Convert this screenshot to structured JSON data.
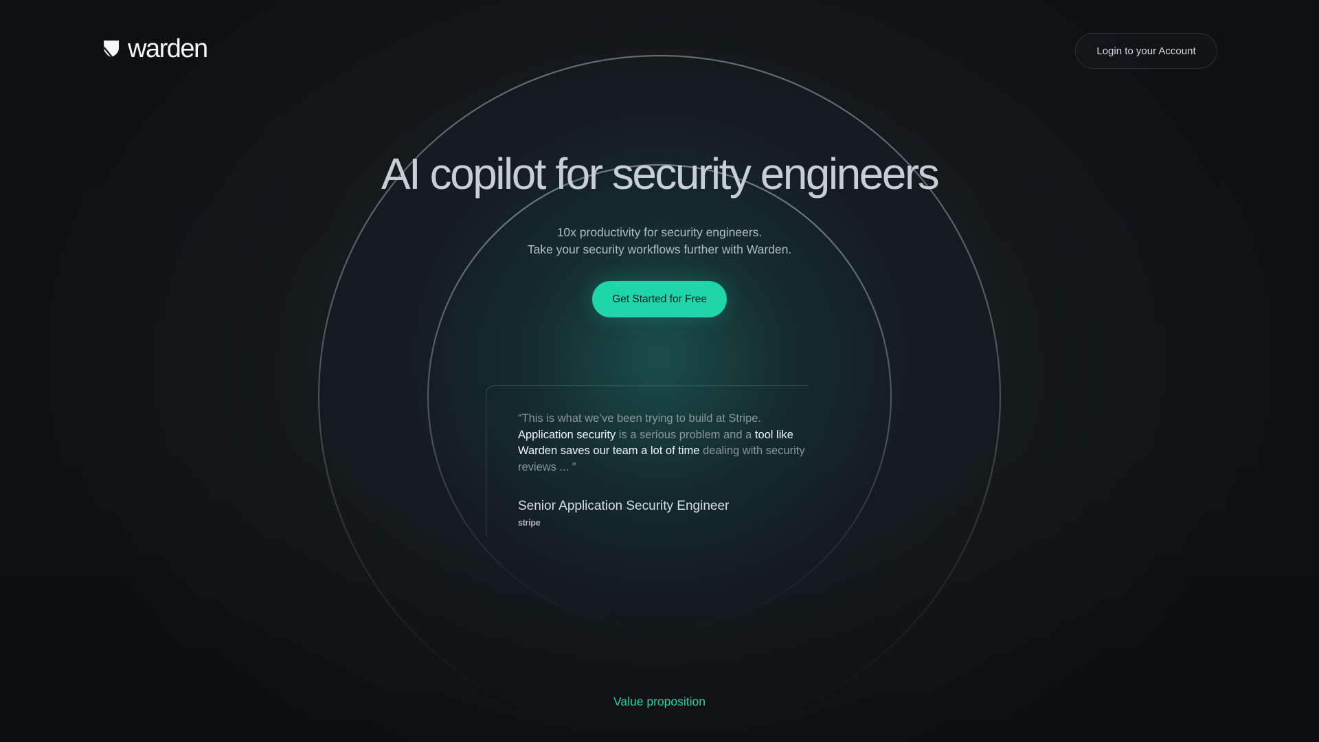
{
  "brand": {
    "logo_icon": "warden-shield-icon",
    "name": "warden"
  },
  "header": {
    "login_label": "Login to your Account"
  },
  "hero": {
    "title": "AI copilot for security engineers",
    "subtitle_line1": "10x productivity for security engineers.",
    "subtitle_line2": "Take your security workflows further with Warden.",
    "cta_label": "Get Started for Free"
  },
  "testimonial": {
    "quote_parts": [
      {
        "text": "“This is what we’ve been trying to build at Stripe. ",
        "highlight": false
      },
      {
        "text": "Application security",
        "highlight": true
      },
      {
        "text": " is a serious problem and a ",
        "highlight": false
      },
      {
        "text": "tool like Warden saves our team a lot of time",
        "highlight": true
      },
      {
        "text": " dealing with security reviews ... ”",
        "highlight": false
      }
    ],
    "author_title": "Senior Application Security Engineer",
    "company": "stripe"
  },
  "section": {
    "label": "Value proposition"
  },
  "colors": {
    "accent": "#1fd6ab",
    "accent_text": "#22d3a6",
    "background": "#131619",
    "quote_dim": "#8c979d",
    "quote_highlight": "#f3f6f7"
  }
}
